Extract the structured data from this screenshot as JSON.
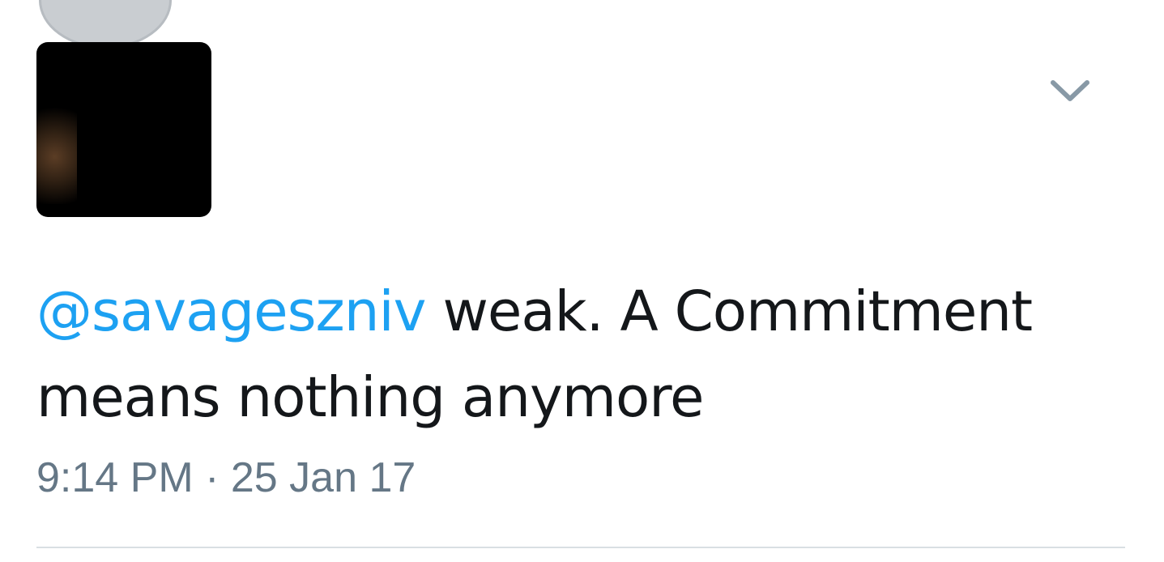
{
  "tweet": {
    "mention": "@savageszniv",
    "text_after_mention": " weak. A Commitment means nothing anymore",
    "timestamp": "9:14 PM · 25 Jan 17"
  },
  "icons": {
    "top_button": "star-icon",
    "menu": "chevron-down-icon"
  },
  "colors": {
    "mention": "#1da1f2",
    "text": "#14171a",
    "meta": "#657786",
    "divider": "#d9dfe3"
  }
}
